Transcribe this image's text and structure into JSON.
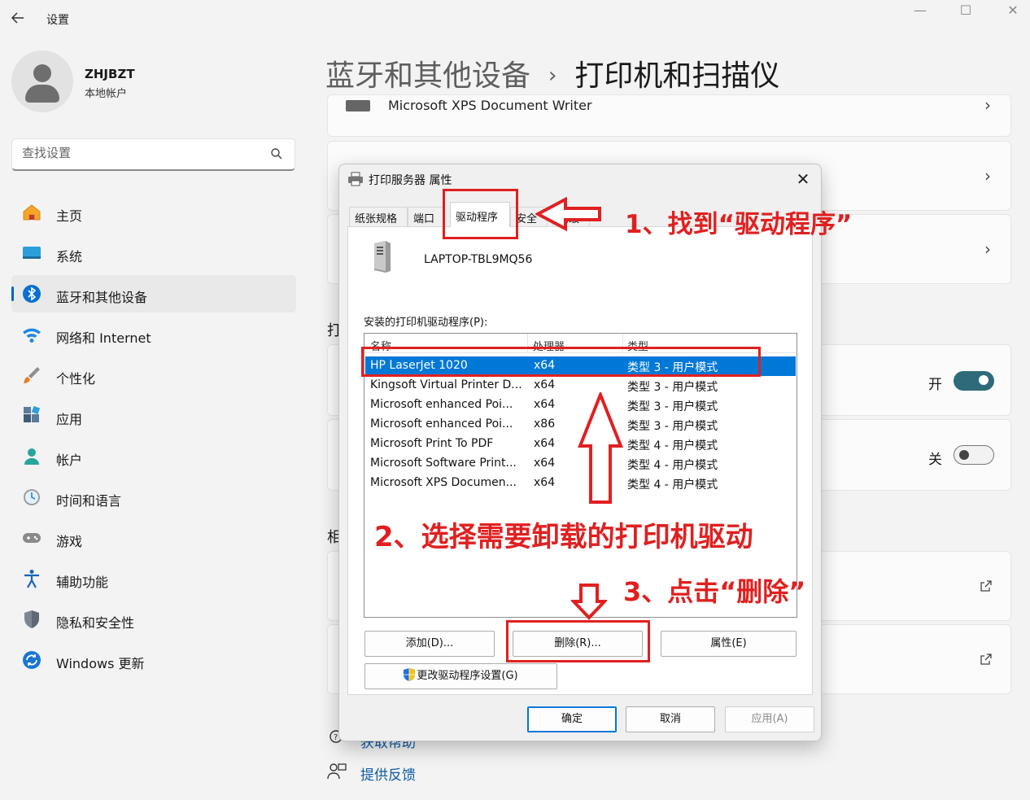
{
  "app": {
    "title": "设置"
  },
  "window_controls": {
    "minimize": "—",
    "maximize": "☐",
    "close": "✕"
  },
  "account": {
    "name": "ZHJBZT",
    "type": "本地帐户"
  },
  "search": {
    "placeholder": "查找设置"
  },
  "nav": [
    {
      "label": "主页",
      "icon": "home-icon"
    },
    {
      "label": "系统",
      "icon": "system-icon"
    },
    {
      "label": "蓝牙和其他设备",
      "icon": "bluetooth-icon",
      "active": true
    },
    {
      "label": "网络和 Internet",
      "icon": "wifi-icon"
    },
    {
      "label": "个性化",
      "icon": "brush-icon"
    },
    {
      "label": "应用",
      "icon": "apps-icon"
    },
    {
      "label": "帐户",
      "icon": "account-icon"
    },
    {
      "label": "时间和语言",
      "icon": "clock-icon"
    },
    {
      "label": "游戏",
      "icon": "gamepad-icon"
    },
    {
      "label": "辅助功能",
      "icon": "accessibility-icon"
    },
    {
      "label": "隐私和安全性",
      "icon": "shield-icon"
    },
    {
      "label": "Windows 更新",
      "icon": "update-icon"
    }
  ],
  "breadcrumb": {
    "parent": "蓝牙和其他设备",
    "separator": "›",
    "current": "打印机和扫描仪"
  },
  "content": {
    "printer_item": "Microsoft XPS Document Writer",
    "section_partial_1": "打",
    "section_partial_2": "相",
    "toggle_on_label": "开",
    "toggle_off_label": "关",
    "help_link": "获取帮助",
    "feedback_link": "提供反馈"
  },
  "dialog": {
    "title": "打印服务器 属性",
    "tabs": [
      "纸张规格",
      "端口",
      "驱动程序",
      "安全",
      "高级"
    ],
    "active_tab": "驱动程序",
    "server_name": "LAPTOP-TBL9MQ56",
    "list_label": "安装的打印机驱动程序(P):",
    "columns": [
      "名称",
      "处理器",
      "类型"
    ],
    "drivers": [
      {
        "name": "HP LaserJet 1020",
        "processor": "x64",
        "type": "类型 3 - 用户模式",
        "selected": true
      },
      {
        "name": "Kingsoft Virtual Printer D...",
        "processor": "x64",
        "type": "类型 3 - 用户模式"
      },
      {
        "name": "Microsoft enhanced Poi...",
        "processor": "x64",
        "type": "类型 3 - 用户模式"
      },
      {
        "name": "Microsoft enhanced Poi...",
        "processor": "x86",
        "type": "类型 3 - 用户模式"
      },
      {
        "name": "Microsoft Print To PDF",
        "processor": "x64",
        "type": "类型 4 - 用户模式"
      },
      {
        "name": "Microsoft Software Print...",
        "processor": "x64",
        "type": "类型 4 - 用户模式"
      },
      {
        "name": "Microsoft XPS Documen...",
        "processor": "x64",
        "type": "类型 4 - 用户模式"
      }
    ],
    "buttons": {
      "add": "添加(D)...",
      "remove": "删除(R)...",
      "properties": "属性(E)",
      "change_settings": "更改驱动程序设置(G)",
      "ok": "确定",
      "cancel": "取消",
      "apply": "应用(A)"
    }
  },
  "annotations": {
    "step1": "1、找到“驱动程序”",
    "step2": "2、选择需要卸载的打印机驱动",
    "step3": "3、点击“删除”",
    "color": "#e02020"
  }
}
